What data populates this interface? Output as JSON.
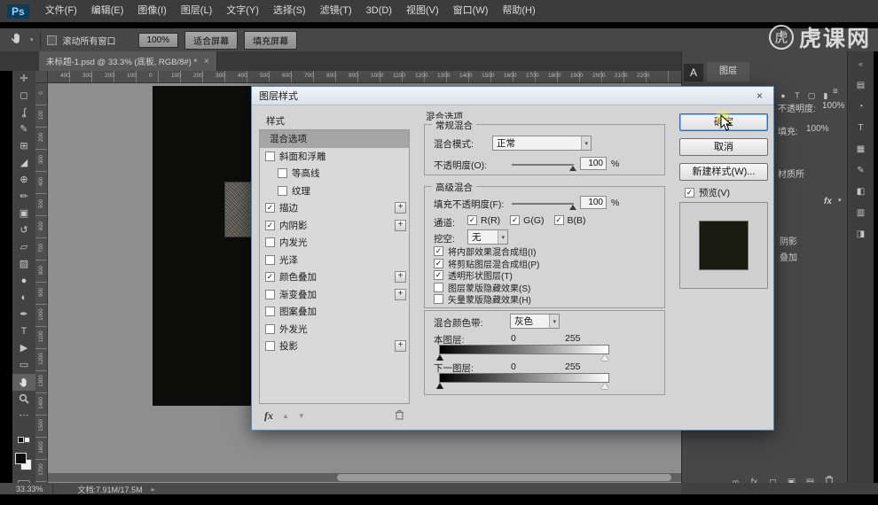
{
  "app": {
    "logo": "Ps",
    "menus": [
      "文件(F)",
      "编辑(E)",
      "图像(I)",
      "图层(L)",
      "文字(Y)",
      "选择(S)",
      "滤镜(T)",
      "3D(D)",
      "视图(V)",
      "窗口(W)",
      "帮助(H)"
    ]
  },
  "options_bar": {
    "scroll_all_windows": "滚动所有窗口",
    "zoom_100": "100%",
    "fit_screen": "适合屏幕",
    "fill_screen": "填充屏幕"
  },
  "watermark": {
    "logo": "虎",
    "text": "虎课网"
  },
  "document_tab": {
    "title": "未标题-1.psd @ 33.3% (底板, RGB/8#) *",
    "close": "×"
  },
  "rulers": {
    "horizontal": [
      "400",
      "300",
      "200",
      "100",
      "0",
      "100",
      "200",
      "300",
      "400",
      "500",
      "600",
      "700",
      "800",
      "900",
      "1000",
      "1100",
      "1200",
      "1300",
      "1400",
      "1500",
      "1600",
      "1700",
      "1800",
      "1900",
      "2000",
      "2100",
      "2200"
    ],
    "vertical": [
      "0",
      "100",
      "200",
      "300",
      "400",
      "500",
      "600",
      "700",
      "800",
      "900",
      "1000",
      "1100",
      "1200",
      "1300",
      "1400",
      "1500",
      "1600",
      "1700"
    ]
  },
  "toolbar": {
    "tools": [
      {
        "name": "move-tool",
        "glyph": "✛"
      },
      {
        "name": "marquee-tool",
        "glyph": "◻"
      },
      {
        "name": "lasso-tool",
        "glyph": "ʆ"
      },
      {
        "name": "quick-selection-tool",
        "glyph": "✎"
      },
      {
        "name": "crop-tool",
        "glyph": "⊞"
      },
      {
        "name": "eyedropper-tool",
        "glyph": "◢"
      },
      {
        "name": "healing-brush-tool",
        "glyph": "⊕"
      },
      {
        "name": "brush-tool",
        "glyph": "✏"
      },
      {
        "name": "clone-stamp-tool",
        "glyph": "▣"
      },
      {
        "name": "history-brush-tool",
        "glyph": "↺"
      },
      {
        "name": "eraser-tool",
        "glyph": "▱"
      },
      {
        "name": "gradient-tool",
        "glyph": "▨"
      },
      {
        "name": "blur-tool",
        "glyph": "●"
      },
      {
        "name": "dodge-tool",
        "glyph": "◐"
      },
      {
        "name": "pen-tool",
        "glyph": "✒"
      },
      {
        "name": "type-tool",
        "glyph": "T"
      },
      {
        "name": "path-selection-tool",
        "glyph": "▶"
      },
      {
        "name": "shape-tool",
        "glyph": "▭"
      },
      {
        "name": "hand-tool",
        "glyph": "",
        "selected": true
      },
      {
        "name": "zoom-tool",
        "glyph": ""
      },
      {
        "name": "more-tools",
        "glyph": "⋯"
      }
    ]
  },
  "dialog": {
    "title": "图层样式",
    "close": "×",
    "styles_panel": {
      "header": "样式",
      "items": [
        {
          "label": "混合选项",
          "selected": true,
          "checkbox": false,
          "checked": false,
          "plus": false
        },
        {
          "label": "斜面和浮雕",
          "checkbox": true,
          "checked": false,
          "plus": false
        },
        {
          "label": "等高线",
          "checkbox": true,
          "checked": false,
          "plus": false,
          "indent": true
        },
        {
          "label": "纹理",
          "checkbox": true,
          "checked": false,
          "plus": false,
          "indent": true
        },
        {
          "label": "描边",
          "checkbox": true,
          "checked": true,
          "plus": true
        },
        {
          "label": "内阴影",
          "checkbox": true,
          "checked": true,
          "plus": true
        },
        {
          "label": "内发光",
          "checkbox": true,
          "checked": false,
          "plus": false
        },
        {
          "label": "光泽",
          "checkbox": true,
          "checked": false,
          "plus": false
        },
        {
          "label": "颜色叠加",
          "checkbox": true,
          "checked": true,
          "plus": true
        },
        {
          "label": "渐变叠加",
          "checkbox": true,
          "checked": false,
          "plus": true
        },
        {
          "label": "图案叠加",
          "checkbox": true,
          "checked": false,
          "plus": false
        },
        {
          "label": "外发光",
          "checkbox": true,
          "checked": false,
          "plus": false
        },
        {
          "label": "投影",
          "checkbox": true,
          "checked": false,
          "plus": true
        }
      ],
      "footer": {
        "fx": "fx",
        "up": "▲",
        "down": "▼"
      }
    },
    "content": {
      "section_title": "混合选项",
      "general": {
        "group_title": "常规混合",
        "blend_mode_label": "混合模式:",
        "blend_mode_value": "正常",
        "opacity_label": "不透明度(O):",
        "opacity_value": "100",
        "percent": "%"
      },
      "advanced": {
        "group_title": "高级混合",
        "fill_opacity_label": "填充不透明度(F):",
        "fill_opacity_value": "100",
        "percent": "%",
        "channels_label": "通道:",
        "channels": [
          {
            "label": "R(R)",
            "checked": true
          },
          {
            "label": "G(G)",
            "checked": true
          },
          {
            "label": "B(B)",
            "checked": true
          }
        ],
        "knockout_label": "挖空:",
        "knockout_value": "无",
        "checks": [
          {
            "label": "将内部效果混合成组(I)",
            "checked": true
          },
          {
            "label": "将剪贴图层混合成组(P)",
            "checked": true
          },
          {
            "label": "透明形状图层(T)",
            "checked": true
          },
          {
            "label": "图层蒙版隐藏效果(S)",
            "checked": false
          },
          {
            "label": "矢量蒙版隐藏效果(H)",
            "checked": false
          }
        ]
      },
      "blend_if": {
        "group_title": "混合颜色带:",
        "mode_value": "灰色",
        "this_layer_label": "本图层:",
        "this_layer_min": "0",
        "this_layer_max": "255",
        "underlying_label": "下一图层:",
        "underlying_min": "0",
        "underlying_max": "255"
      }
    },
    "buttons": {
      "ok": "确定",
      "cancel": "取消",
      "new_style": "新建样式(W)...",
      "preview": "预览(V)"
    }
  },
  "right_panel": {
    "char_icon": "A",
    "layers_tab": "图层",
    "panel_menu": "≡",
    "filter_icons": [
      "●",
      "T",
      "▢",
      "▮"
    ],
    "opacity_label": "不透明度:",
    "opacity_value": "100%",
    "fill_label": "填充:",
    "fill_value": "100%",
    "layer_fragment": "材质所",
    "fx_badge": "fx",
    "fx_expander": "▾",
    "effect_fragment_1": "阴影",
    "effect_fragment_2": "叠加",
    "bottom_icons": [
      "∞",
      "fx",
      "◻",
      "▣",
      "▤"
    ]
  },
  "right_strip": {
    "collapse": "«",
    "icons": [
      "▤",
      "◔",
      "T",
      "▦",
      "✎",
      "◧",
      "▥",
      "◨"
    ]
  },
  "status_bar": {
    "zoom": "33.33%",
    "doc_label": "文档:7.91M/17.5M",
    "arrow": "▸"
  }
}
